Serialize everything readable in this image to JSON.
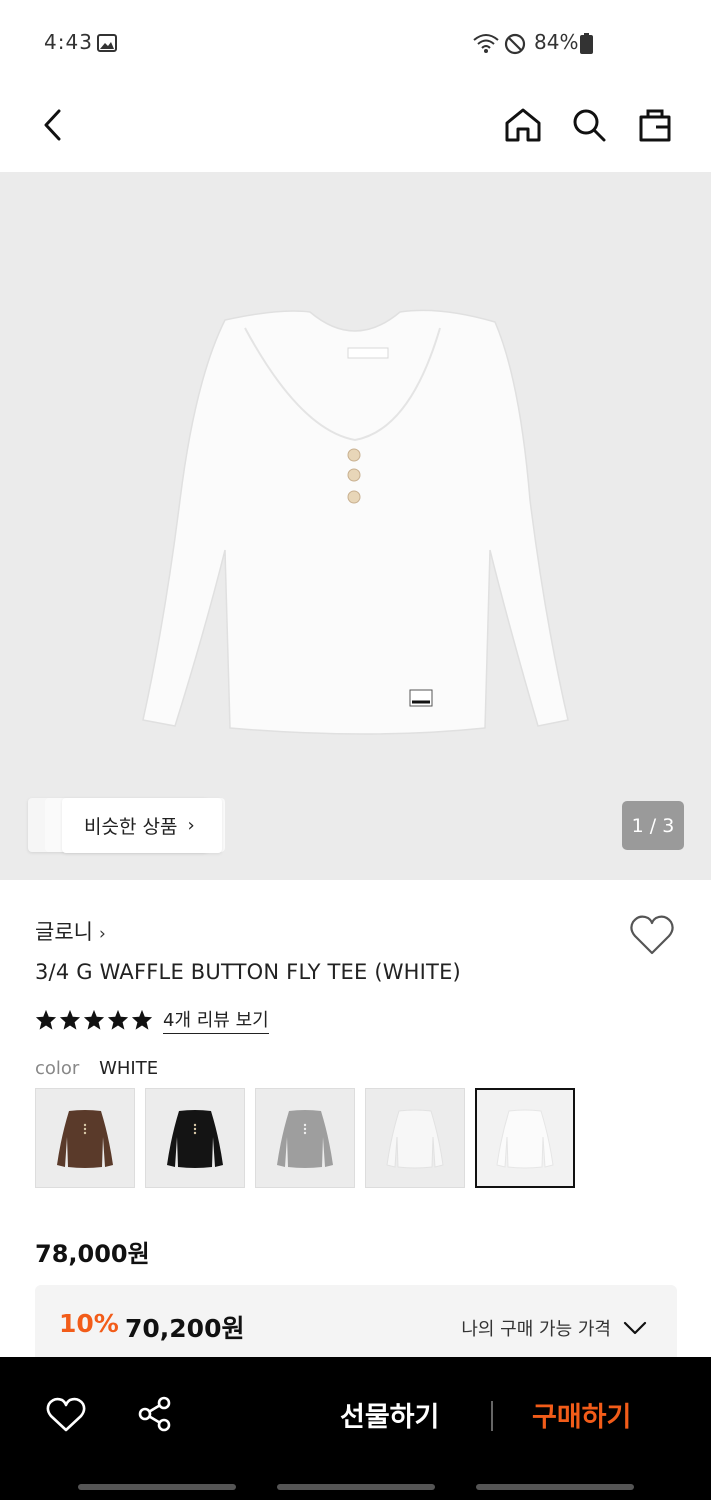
{
  "status_bar": {
    "time": "4:43",
    "battery": "84%",
    "icons": [
      "image-icon",
      "wifi-icon",
      "do-not-disturb-icon",
      "battery-icon"
    ]
  },
  "top_nav": {
    "icons": [
      "back-icon",
      "home-icon",
      "search-icon",
      "shopping-bag-icon"
    ]
  },
  "hero": {
    "similar_label": "비슷한 상품",
    "page_counter": "1 / 3",
    "background_color": "#ebebeb"
  },
  "product": {
    "brand": "글로니",
    "title": "3/4 G WAFFLE BUTTON FLY TEE (WHITE)",
    "rating_stars": 5,
    "review_link": "4개 리뷰 보기",
    "color_label": "color",
    "color_value": "WHITE",
    "swatches": [
      {
        "color": "#5a3a2a",
        "selected": false
      },
      {
        "color": "#141414",
        "selected": false
      },
      {
        "color": "#9e9e9e",
        "selected": false
      },
      {
        "color": "#f5f5f5",
        "selected": false
      },
      {
        "color": "#fafafa",
        "selected": true
      }
    ],
    "price_original": "78,000원",
    "discount_percent": "10%",
    "discount_price": "70,200원",
    "my_price_label": "나의 구매 가능 가격"
  },
  "bottom_bar": {
    "gift_label": "선물하기",
    "buy_label": "구매하기",
    "accent_color": "#f25c19"
  }
}
